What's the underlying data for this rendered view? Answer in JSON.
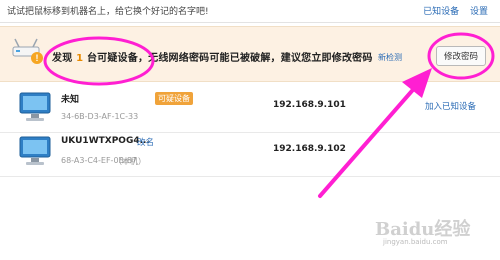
{
  "topbar": {
    "hint": "试试把鼠标移到机器名上，给它换个好记的名字吧!",
    "known_devices": "已知设备",
    "settings": "设置"
  },
  "alert": {
    "text_pre": "发现",
    "count": "1",
    "text_post": "台可疑设备，无线网络密码可能已被破解，建议您立即修改密码",
    "recheck": "新检测",
    "change_password": "修改密码"
  },
  "devices": [
    {
      "name": "未知",
      "mac": "34-6B-D3-AF-1C-33",
      "badge": "可疑设备",
      "ip": "192.168.9.101",
      "action": "加入已知设备"
    },
    {
      "name": "UKU1WTXPOG4...",
      "rename": "改名",
      "mac": "68-A3-C4-EF-0B-87",
      "local": "（本机）",
      "ip": "192.168.9.102"
    }
  ],
  "watermark": {
    "text": "Baidu经验",
    "sub": "jingyan.baidu.com"
  },
  "colors": {
    "annotation": "#ff1fd2",
    "link": "#2a6bb5",
    "badge": "#f0a33a"
  }
}
